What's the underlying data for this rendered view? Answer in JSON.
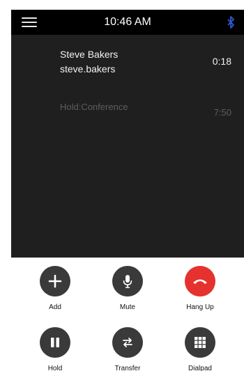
{
  "status": {
    "time": "10:46 AM"
  },
  "active_call": {
    "name": "Steve Bakers",
    "id": "steve.bakers",
    "timer": "0:18"
  },
  "held_call": {
    "label": "Hold:Conference",
    "timer": "7:50"
  },
  "controls": [
    {
      "label": "Add",
      "icon": "plus-icon"
    },
    {
      "label": "Mute",
      "icon": "microphone-icon"
    },
    {
      "label": "Hang Up",
      "icon": "hang-up-icon",
      "color": "#e5322f"
    },
    {
      "label": "Hold",
      "icon": "pause-icon"
    },
    {
      "label": "Transfer",
      "icon": "transfer-icon"
    },
    {
      "label": "Dialpad",
      "icon": "dialpad-icon"
    }
  ]
}
